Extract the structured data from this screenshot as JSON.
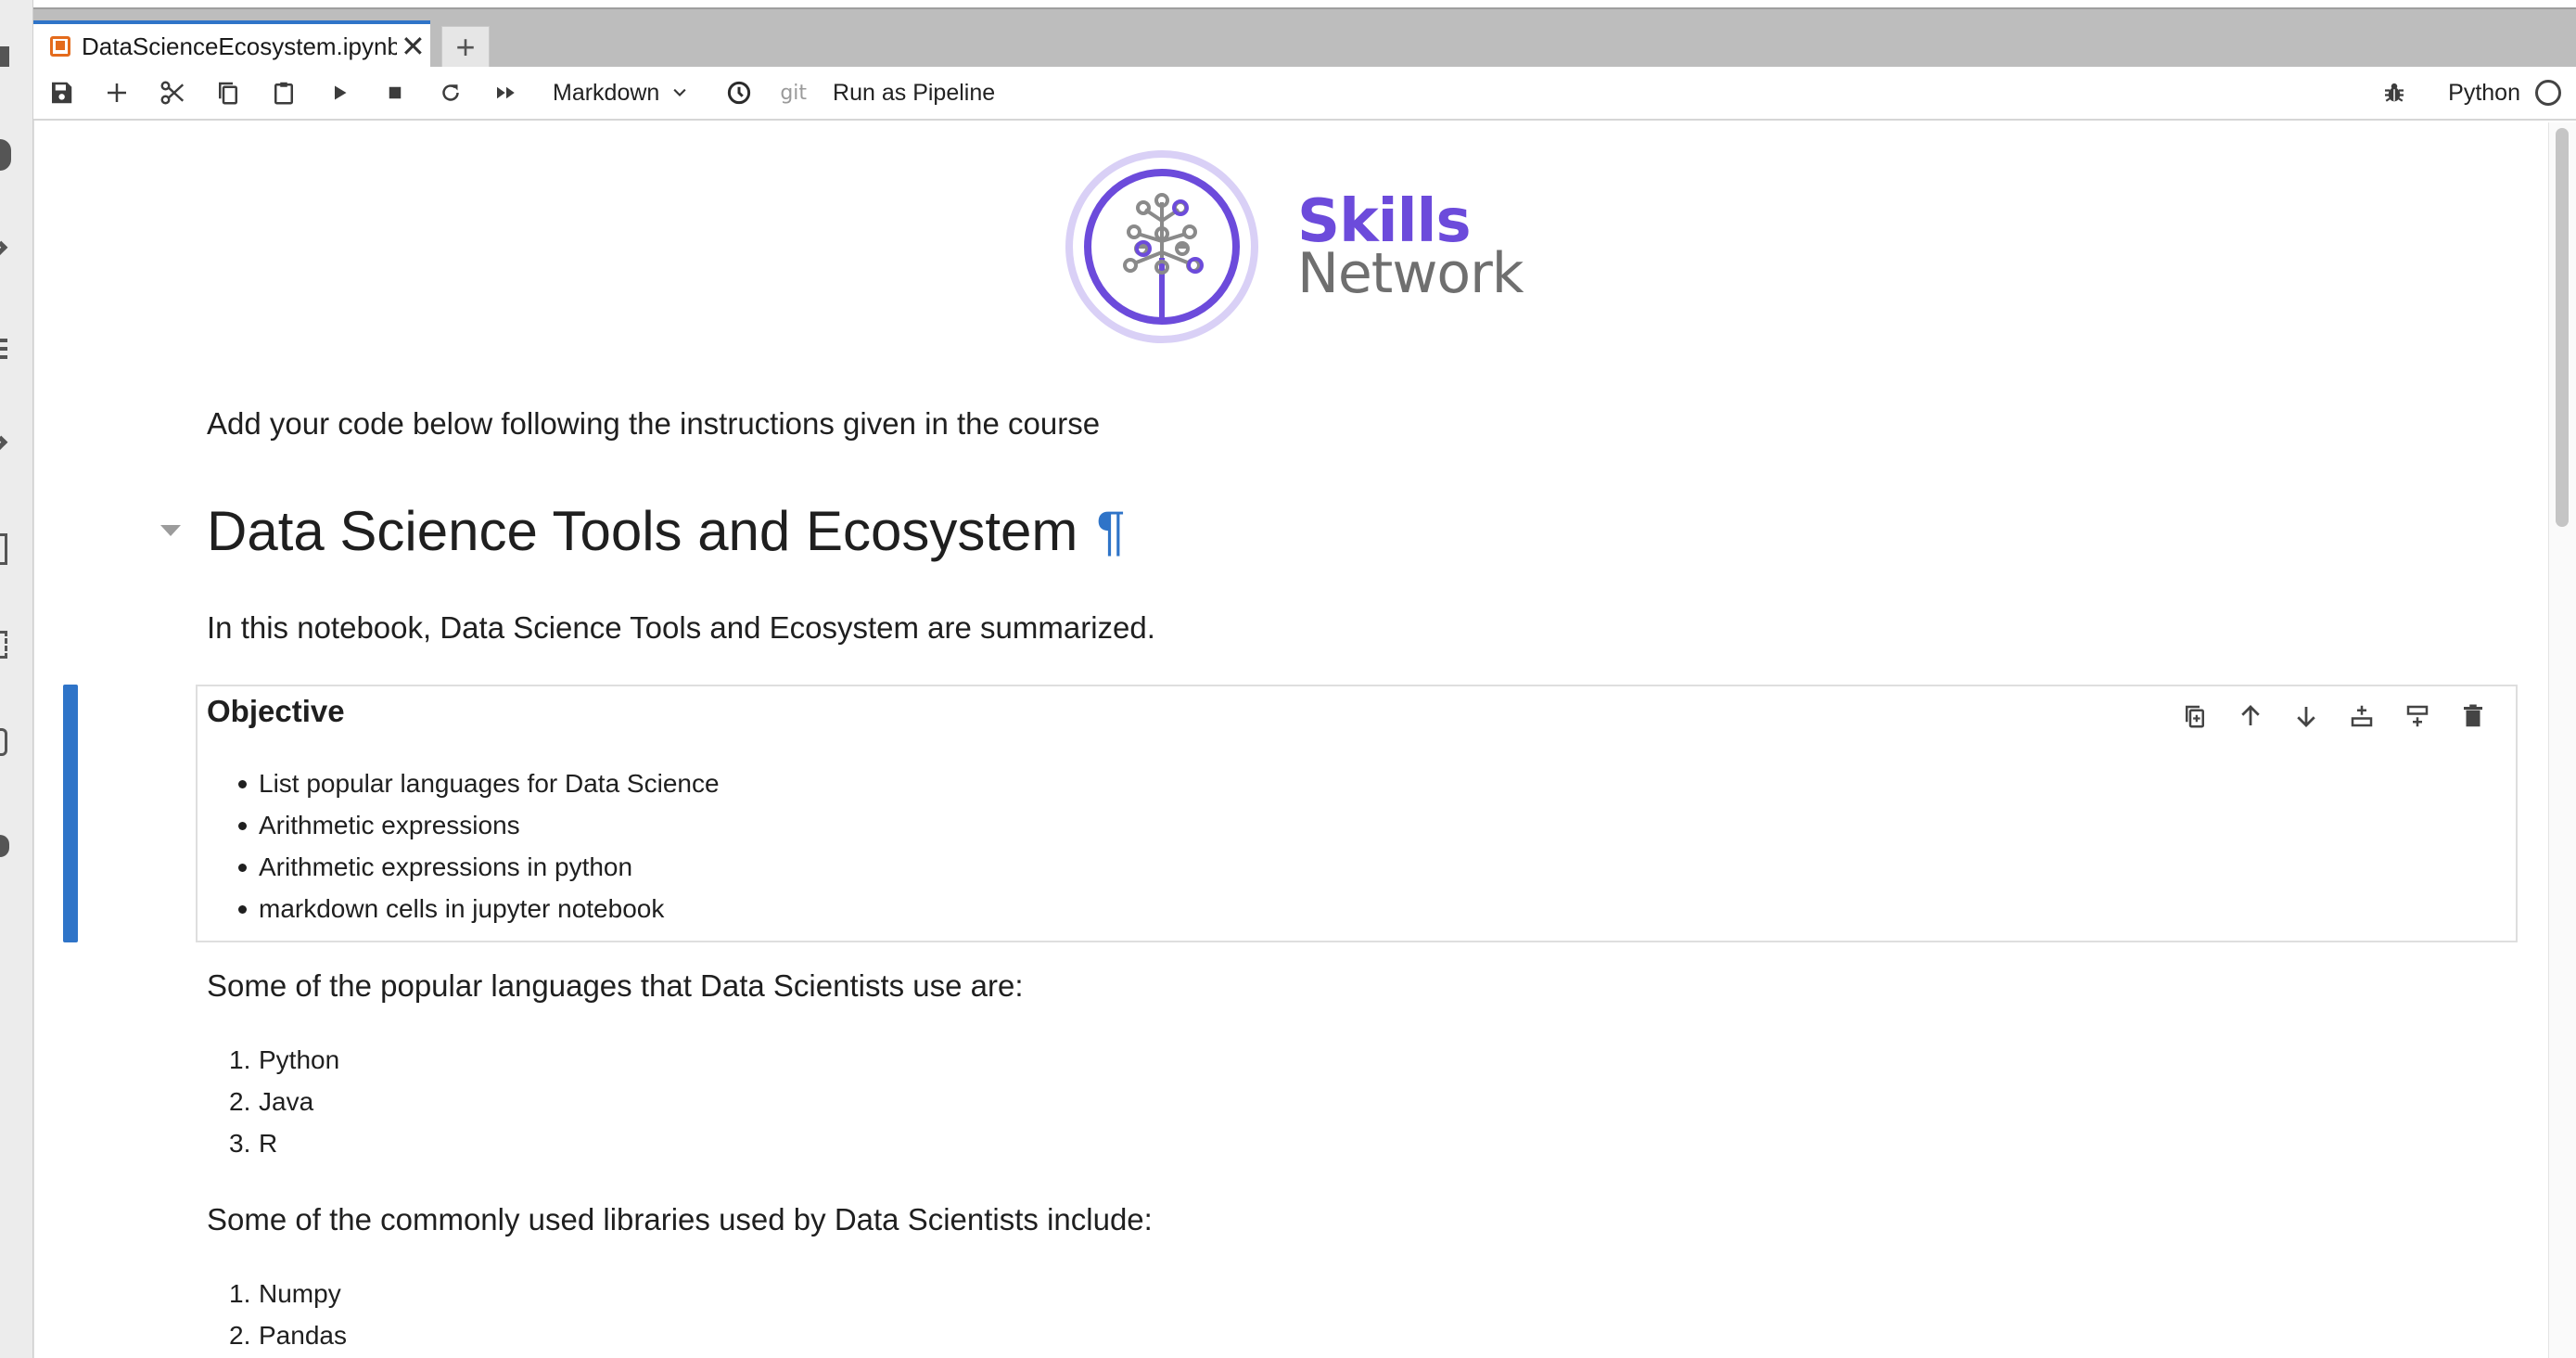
{
  "tab": {
    "title": "DataScienceEcosystem.ipynb",
    "close_glyph": "✕",
    "new_tab_glyph": "+"
  },
  "toolbar": {
    "buttons": [
      {
        "name": "save-button",
        "icon": "save-icon"
      },
      {
        "name": "insert-cell-button",
        "icon": "plus-icon"
      },
      {
        "name": "cut-button",
        "icon": "scissors-icon"
      },
      {
        "name": "copy-button",
        "icon": "copy-icon"
      },
      {
        "name": "paste-button",
        "icon": "clipboard-icon"
      },
      {
        "name": "run-button",
        "icon": "play-icon"
      },
      {
        "name": "interrupt-button",
        "icon": "stop-icon"
      },
      {
        "name": "restart-button",
        "icon": "refresh-icon"
      },
      {
        "name": "run-all-button",
        "icon": "fast-forward-icon"
      }
    ],
    "cell_type": "Markdown",
    "git_label": "git",
    "pipeline_label": "Run as Pipeline",
    "kernel_name": "Python"
  },
  "logo": {
    "line1": "Skills",
    "line2": "Network",
    "colors": {
      "primary": "#6c4bdb",
      "light": "#d9d0f6",
      "grey": "#6f6f6f"
    }
  },
  "notebook": {
    "instructions": "Add your code below following the instructions given in the course",
    "heading": "Data Science Tools and Ecosystem",
    "heading_anchor": "¶",
    "summary": "In this notebook, Data Science Tools and Ecosystem are summarized.",
    "objective": {
      "title": "Objective",
      "items": [
        "List popular languages for Data Science",
        "Arithmetic expressions",
        "Arithmetic expressions in python",
        "markdown cells in jupyter notebook"
      ]
    },
    "languages_intro": "Some of the popular languages that Data Scientists use are:",
    "languages": [
      "Python",
      "Java",
      "R"
    ],
    "libraries_intro": "Some of the commonly used libraries used by Data Scientists include:",
    "libraries": [
      "Numpy",
      "Pandas"
    ]
  },
  "cell_toolbar": [
    "duplicate-cell-icon",
    "move-up-icon",
    "move-down-icon",
    "insert-above-icon",
    "insert-below-icon",
    "delete-cell-icon"
  ],
  "colors": {
    "accent": "#2f74c8",
    "notebook_icon": "#e46b1c"
  }
}
